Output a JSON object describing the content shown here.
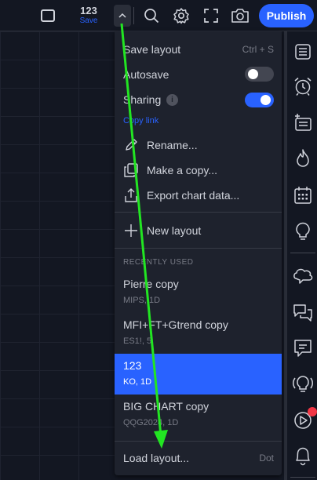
{
  "toolbar": {
    "layout_name": "123",
    "save_label": "Save",
    "publish_label": "Publish"
  },
  "menu": {
    "save_layout": {
      "label": "Save layout",
      "shortcut": "Ctrl + S"
    },
    "autosave": {
      "label": "Autosave",
      "enabled": false
    },
    "sharing": {
      "label": "Sharing",
      "enabled": true,
      "info_glyph": "i"
    },
    "copy_link": "Copy link",
    "rename": "Rename...",
    "make_copy": "Make a copy...",
    "export": "Export chart data...",
    "new_layout": "New layout",
    "recently_used_title": "RECENTLY USED",
    "recent": [
      {
        "name": "Pierre copy",
        "sub": "MIPS, 1D",
        "active": false
      },
      {
        "name": "MFI+FT+Gtrend copy",
        "sub": "ES1!, 5",
        "active": false
      },
      {
        "name": "123",
        "sub": "KO, 1D",
        "active": true
      },
      {
        "name": "BIG CHART copy",
        "sub": "QQG2024, 1D",
        "active": false
      }
    ],
    "load_layout": {
      "label": "Load layout...",
      "shortcut": "Dot"
    }
  },
  "icons": {
    "toolbar": [
      "layout-square-icon",
      "chevron-up-icon",
      "search-icon",
      "gear-icon",
      "fullscreen-icon",
      "camera-icon"
    ],
    "sidebar": [
      "watchlist-icon",
      "alarm-clock-icon",
      "news-icon",
      "hotlist-fire-icon",
      "calendar-icon",
      "ideas-lightbulb-icon",
      "chats-icon",
      "community-icon",
      "messages-icon",
      "live-stream-icon",
      "play-icon",
      "notifications-bell-icon"
    ]
  },
  "colors": {
    "background": "#131722",
    "menu_bg": "#1e222d",
    "accent": "#2962ff",
    "annotation_arrow": "#22e522",
    "notification_dot": "#f23645"
  }
}
